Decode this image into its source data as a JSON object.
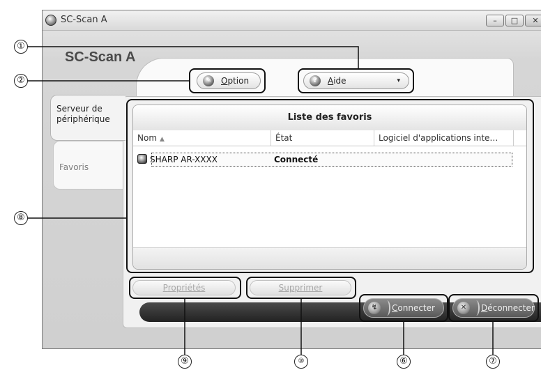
{
  "window": {
    "title": "SC-Scan A",
    "controls": {
      "minimize": "–",
      "maximize": "□",
      "close": "✕"
    }
  },
  "app": {
    "heading": "SC-Scan A"
  },
  "toolbar": {
    "option": {
      "label_mnemonic": "O",
      "label_rest": "ption",
      "icon": "wrench-icon"
    },
    "aide": {
      "label_mnemonic": "A",
      "label_rest": "ide",
      "caret": "▾",
      "icon": "help-icon"
    }
  },
  "sidebar": {
    "tabs": [
      {
        "label": "Serveur de périphérique",
        "active": true
      },
      {
        "label": "Favoris",
        "active": false
      }
    ]
  },
  "favorites": {
    "title": "Liste des favoris",
    "columns": [
      "Nom",
      "État",
      "Logiciel d'applications inte…"
    ],
    "sort_indicator": "▲",
    "rows": [
      {
        "nom": "SHARP AR-XXXX",
        "etat": "Connecté",
        "logiciel": ""
      }
    ]
  },
  "buttons": {
    "proprietes": {
      "mnemonic": "P",
      "rest": "ropriétés",
      "enabled": false
    },
    "supprimer": {
      "mnemonic": "S",
      "rest": "upprimer",
      "enabled": false
    },
    "connecter": {
      "mnemonic": "C",
      "rest": "onnecter"
    },
    "deconnecter": {
      "mnemonic": "D",
      "rest": "éconnecter"
    }
  },
  "callouts": [
    "①",
    "②",
    "⑥",
    "⑦",
    "⑧",
    "⑨",
    "⑩"
  ]
}
